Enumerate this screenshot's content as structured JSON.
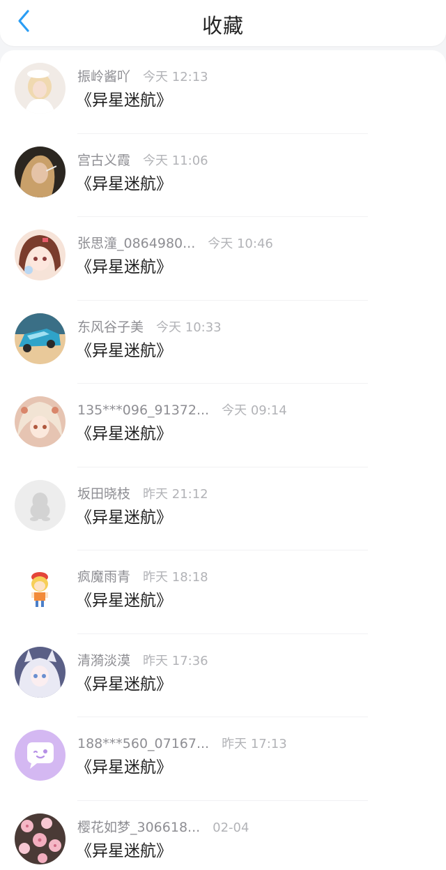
{
  "header": {
    "title": "收藏",
    "back_icon": "chevron-left-icon",
    "accent_color": "#2a9df4"
  },
  "items": [
    {
      "user": "振岭酱吖",
      "time": "今天 12:13",
      "book": "《异星迷航》",
      "avatar": "photo-avatar"
    },
    {
      "user": "宫古义霞",
      "time": "今天 11:06",
      "book": "《异星迷航》",
      "avatar": "photo-avatar"
    },
    {
      "user": "张思潼_0864980...",
      "time": "今天 10:46",
      "book": "《异星迷航》",
      "avatar": "anime-avatar"
    },
    {
      "user": "东风谷子美",
      "time": "今天 10:33",
      "book": "《异星迷航》",
      "avatar": "toy-car-avatar"
    },
    {
      "user": "135***096_91372...",
      "time": "今天 09:14",
      "book": "《异星迷航》",
      "avatar": "anime-avatar"
    },
    {
      "user": "坂田晓枝",
      "time": "昨天 21:12",
      "book": "《异星迷航》",
      "avatar": "default-penguin-avatar"
    },
    {
      "user": "疯魔雨青",
      "time": "昨天 18:18",
      "book": "《异星迷航》",
      "avatar": "cartoon-avatar"
    },
    {
      "user": "清漪淡漠",
      "time": "昨天 17:36",
      "book": "《异星迷航》",
      "avatar": "anime-avatar"
    },
    {
      "user": "188***560_07167...",
      "time": "昨天 17:13",
      "book": "《异星迷航》",
      "avatar": "chat-bubble-avatar"
    },
    {
      "user": "樱花如梦_306618...",
      "time": "02-04",
      "book": "《异星迷航》",
      "avatar": "cherry-blossom-avatar"
    }
  ]
}
